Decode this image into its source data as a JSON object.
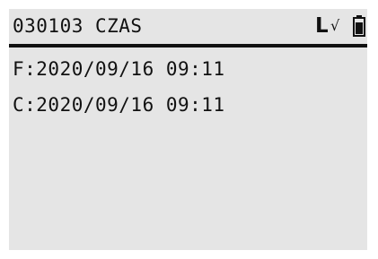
{
  "header": {
    "title": "030103 CZAS",
    "status_letter": "L",
    "status_check": "√",
    "battery_icon": "battery-full-icon"
  },
  "rows": [
    {
      "text": "F:2020/09/16 09:11"
    },
    {
      "text": "C:2020/09/16 09:11"
    }
  ],
  "colors": {
    "screen_background": "#e5e5e5",
    "foreground": "#111111"
  }
}
